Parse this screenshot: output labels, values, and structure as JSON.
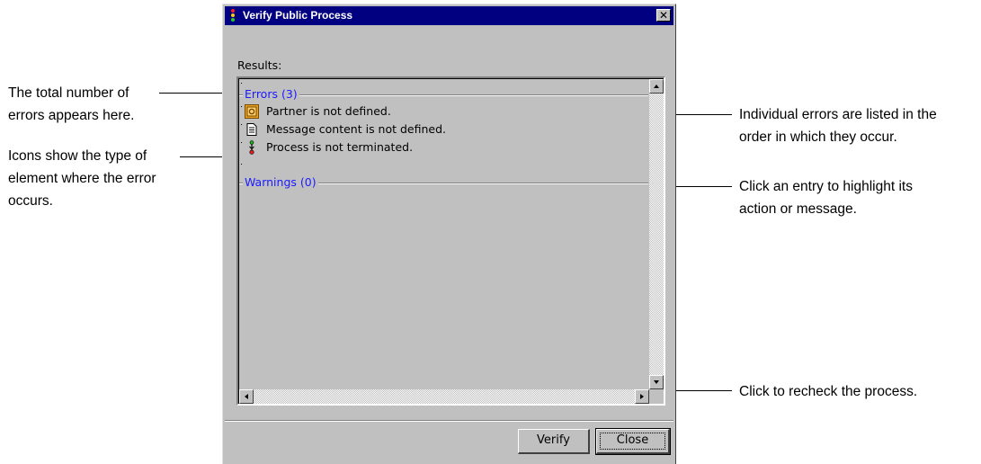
{
  "dialog": {
    "title": "Verify Public Process",
    "close_glyph": "✕",
    "results_label": "Results:",
    "groups": [
      {
        "label": "Errors (3)",
        "items": [
          {
            "icon": "partner-icon",
            "text": "Partner is not defined."
          },
          {
            "icon": "message-document-icon",
            "text": "Message content is not defined."
          },
          {
            "icon": "process-flow-icon",
            "text": "Process is not terminated."
          }
        ]
      },
      {
        "label": "Warnings (0)",
        "items": []
      }
    ],
    "buttons": {
      "verify": "Verify",
      "close": "Close"
    }
  },
  "callouts": {
    "total_errors": [
      "The total number of",
      "errors appears here."
    ],
    "icons_type": [
      "Icons show the type of",
      "element where the error",
      "occurs."
    ],
    "individual_errors": [
      "Individual errors are listed in the",
      "order in which they occur."
    ],
    "click_entry": [
      "Click an entry to highlight its",
      "action or message."
    ],
    "recheck": [
      "Click to recheck the process."
    ]
  },
  "colors": {
    "titlebar": "#000080",
    "window_face": "#c0c0c0",
    "group_label": "#1a1aff"
  }
}
